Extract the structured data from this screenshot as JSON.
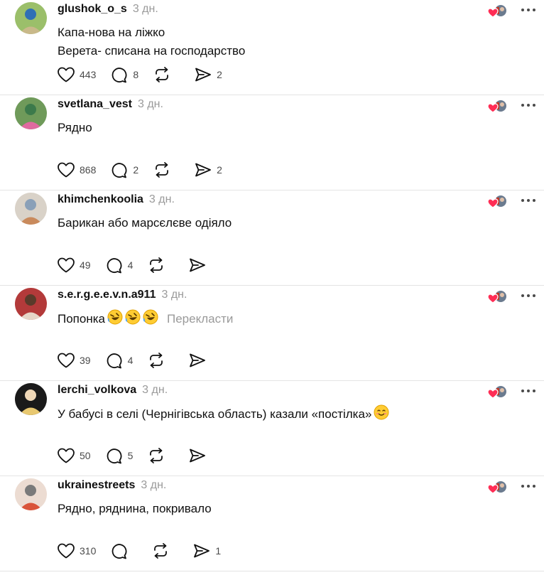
{
  "posts": [
    {
      "username": "glushok_o_s",
      "time": "3 дн.",
      "lines": [
        "Капа-нова на ліжко",
        "Верета- списана на господарство"
      ],
      "likes": "443",
      "replies": "8",
      "reposts": "",
      "shares": "2",
      "avatar_colors": [
        "#9bbf6a",
        "#c9b98a",
        "#2f6fb5"
      ]
    },
    {
      "username": "svetlana_vest",
      "time": "3 дн.",
      "lines": [
        "Рядно"
      ],
      "likes": "868",
      "replies": "2",
      "reposts": "",
      "shares": "2",
      "avatar_colors": [
        "#6f9a5a",
        "#e06aa0",
        "#3c7a4b"
      ]
    },
    {
      "username": "khimchenkoolia",
      "time": "3 дн.",
      "lines": [
        "Барикан або марсєлєве одіяло"
      ],
      "likes": "49",
      "replies": "4",
      "reposts": "",
      "shares": "",
      "avatar_colors": [
        "#d9d2c8",
        "#c98a5c",
        "#8aa0b8"
      ]
    },
    {
      "username": "s.e.r.g.e.e.v.n.a911",
      "time": "3 дн.",
      "lines": [
        "Попонка"
      ],
      "translate": "Перекласти",
      "emojis": [
        "rofl-emoji",
        "rofl-emoji",
        "rofl-emoji"
      ],
      "likes": "39",
      "replies": "4",
      "reposts": "",
      "shares": "",
      "avatar_colors": [
        "#b33a3a",
        "#e6d6c8",
        "#5a3a2a"
      ]
    },
    {
      "username": "lerchi_volkova",
      "time": "3 дн.",
      "lines": [
        "У бабусі в селі (Чернігівська область) казали «постілка»"
      ],
      "emojis": [
        "smiling-blush-emoji"
      ],
      "likes": "50",
      "replies": "5",
      "reposts": "",
      "shares": "",
      "avatar_colors": [
        "#1a1a1a",
        "#e8c870",
        "#f0d8b8"
      ]
    },
    {
      "username": "ukrainestreets",
      "time": "3 дн.",
      "lines": [
        "Рядно, ряднина, покривало"
      ],
      "likes": "310",
      "replies": "",
      "reposts": "",
      "shares": "1",
      "avatar_colors": [
        "#ecdcd2",
        "#d9543a",
        "#7a7a7a"
      ]
    }
  ],
  "colors": {
    "text": "#101010",
    "muted": "#9a9a9a",
    "divider": "#e4e4e4",
    "heart": "#ff2d55"
  }
}
